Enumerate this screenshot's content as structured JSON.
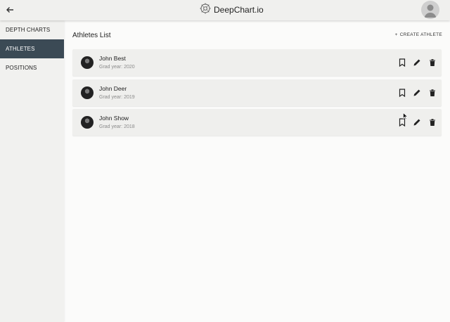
{
  "app": {
    "title": "DeepChart.io"
  },
  "sidebar": {
    "items": [
      {
        "label": "DEPTH CHARTS",
        "active": false
      },
      {
        "label": "ATHLETES",
        "active": true
      },
      {
        "label": "POSITIONS",
        "active": false
      }
    ]
  },
  "main": {
    "title": "Athletes List",
    "create_label": "CREATE ATHLETE",
    "create_icon": "+",
    "grad_label": "Grad year:",
    "athletes": [
      {
        "name": "John Best",
        "grad_year": "2020"
      },
      {
        "name": "John Deer",
        "grad_year": "2019"
      },
      {
        "name": "John Show",
        "grad_year": "2018"
      }
    ]
  },
  "icons": {
    "back": "arrow-left-icon",
    "logo": "gear-logo-icon",
    "avatar": "user-avatar-icon",
    "bookmark": "bookmark-icon",
    "edit": "pencil-icon",
    "delete": "trash-icon"
  },
  "colors": {
    "active_nav": "#3b4a55",
    "card_bg": "#efefed"
  }
}
